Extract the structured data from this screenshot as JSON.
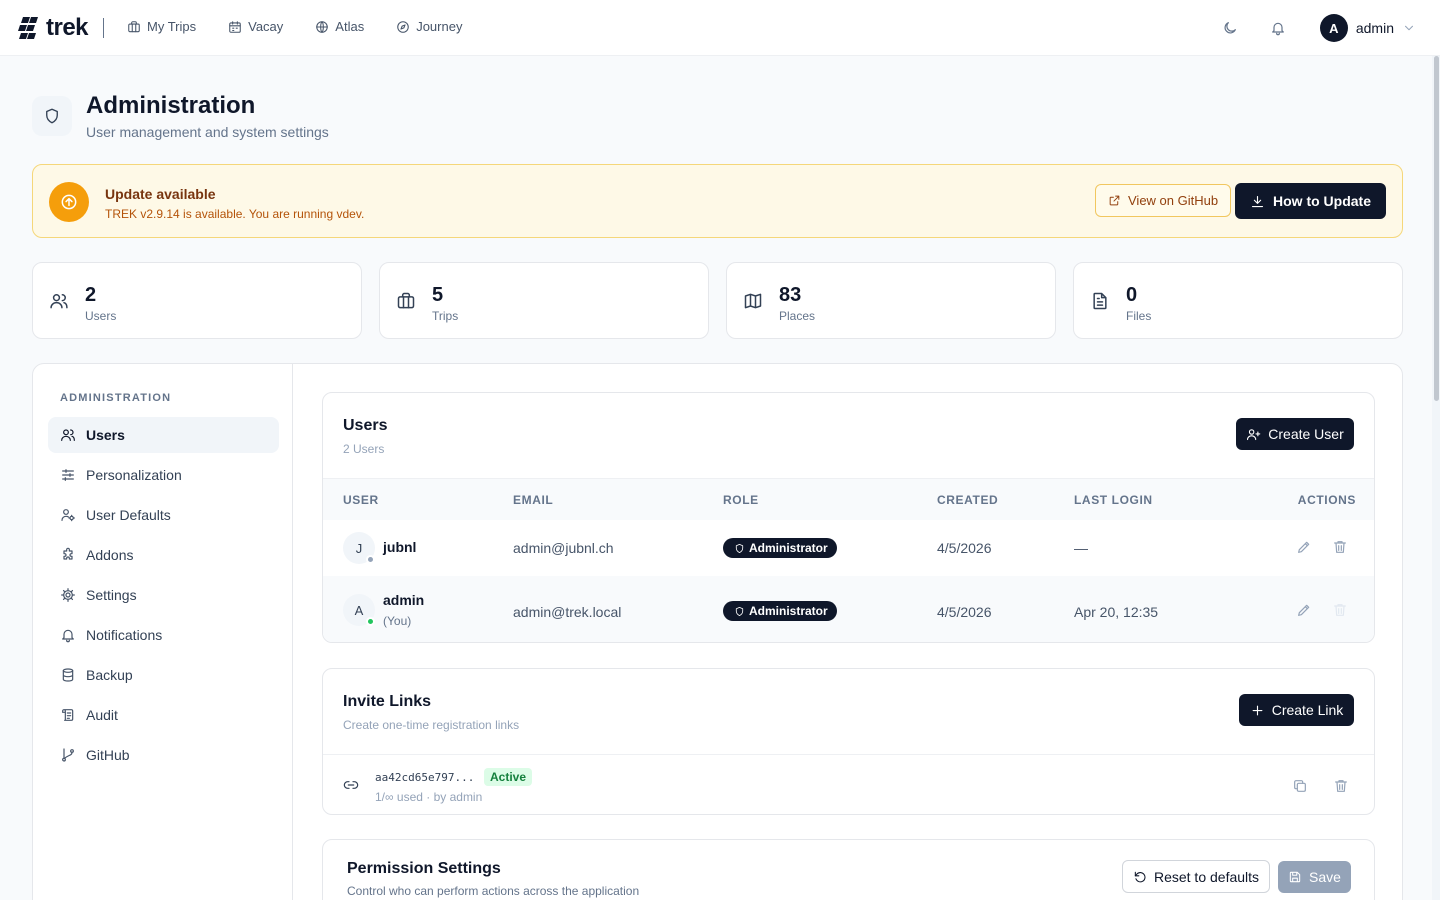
{
  "brand": {
    "name": "trek"
  },
  "nav": [
    {
      "label": "My Trips",
      "icon": "briefcase-icon"
    },
    {
      "label": "Vacay",
      "icon": "calendar-icon"
    },
    {
      "label": "Atlas",
      "icon": "globe-icon"
    },
    {
      "label": "Journey",
      "icon": "compass-icon"
    }
  ],
  "user_menu": {
    "avatar_letter": "A",
    "name": "admin"
  },
  "page": {
    "title": "Administration",
    "subtitle": "User management and system settings"
  },
  "update_banner": {
    "title": "Update available",
    "text": "TREK v2.9.14 is available. You are running vdev.",
    "github_label": "View on GitHub",
    "update_label": "How to Update"
  },
  "stats": [
    {
      "value": "2",
      "label": "Users",
      "icon": "users-icon"
    },
    {
      "value": "5",
      "label": "Trips",
      "icon": "briefcase-icon"
    },
    {
      "value": "83",
      "label": "Places",
      "icon": "map-icon"
    },
    {
      "value": "0",
      "label": "Files",
      "icon": "file-icon"
    }
  ],
  "sidebar": {
    "heading": "ADMINISTRATION",
    "items": [
      {
        "label": "Users",
        "icon": "users-icon",
        "active": true
      },
      {
        "label": "Personalization",
        "icon": "sliders-icon"
      },
      {
        "label": "User Defaults",
        "icon": "user-cog-icon"
      },
      {
        "label": "Addons",
        "icon": "puzzle-icon"
      },
      {
        "label": "Settings",
        "icon": "gear-icon"
      },
      {
        "label": "Notifications",
        "icon": "bell-icon"
      },
      {
        "label": "Backup",
        "icon": "database-icon"
      },
      {
        "label": "Audit",
        "icon": "scroll-icon"
      },
      {
        "label": "GitHub",
        "icon": "git-branch-icon"
      }
    ]
  },
  "users_card": {
    "title": "Users",
    "subtitle": "2 Users",
    "create_label": "Create User",
    "columns": [
      "USER",
      "EMAIL",
      "ROLE",
      "CREATED",
      "LAST LOGIN",
      "ACTIONS"
    ],
    "rows": [
      {
        "initial": "J",
        "name": "jubnl",
        "you": "",
        "email": "admin@jubnl.ch",
        "role": "Administrator",
        "created": "4/5/2026",
        "last_login": "—",
        "online": false
      },
      {
        "initial": "A",
        "name": "admin",
        "you": "(You)",
        "email": "admin@trek.local",
        "role": "Administrator",
        "created": "4/5/2026",
        "last_login": "Apr 20, 12:35",
        "online": true
      }
    ]
  },
  "invite_card": {
    "title": "Invite Links",
    "subtitle": "Create one-time registration links",
    "create_label": "Create Link",
    "links": [
      {
        "code": "aa42cd65e797...",
        "status": "Active",
        "meta": "1/∞ used · by admin"
      }
    ]
  },
  "permission_card": {
    "title": "Permission Settings",
    "subtitle": "Control who can perform actions across the application",
    "reset_label": "Reset to defaults",
    "save_label": "Save"
  },
  "colors": {
    "accent": "#0f172a",
    "warning": "#f59e0b",
    "success": "#22c55e"
  }
}
